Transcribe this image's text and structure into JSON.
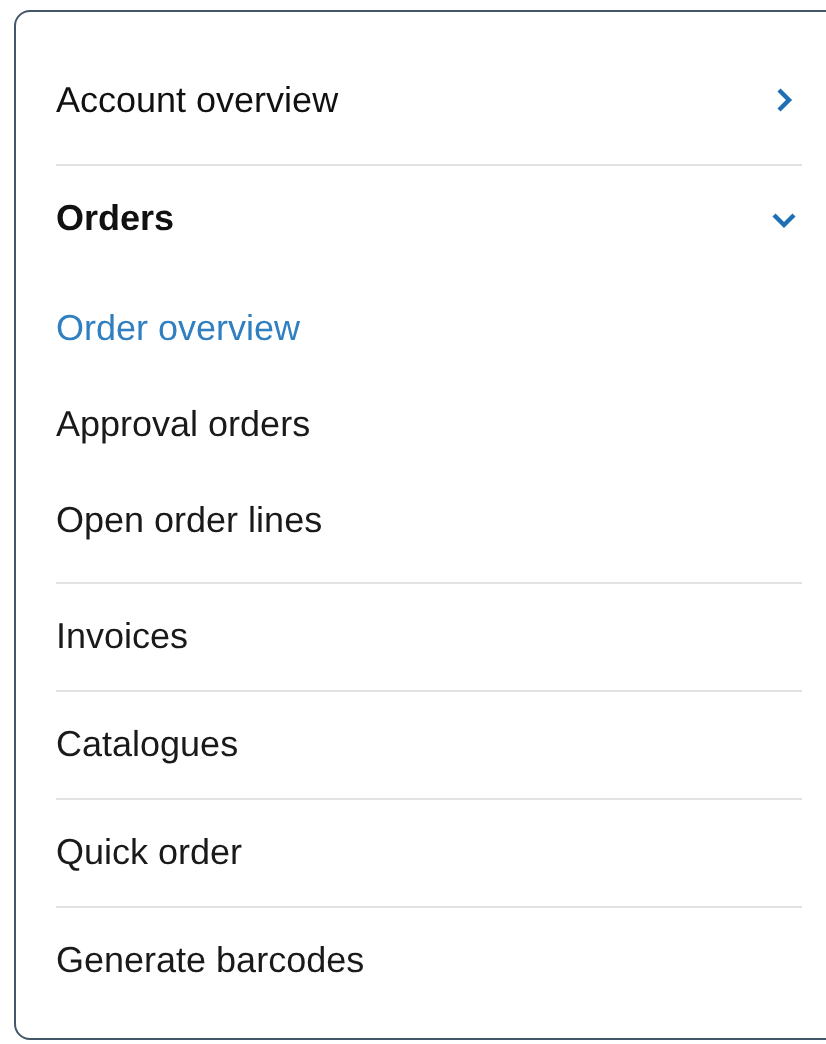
{
  "menu": [
    {
      "label": "Account overview",
      "kind": "group",
      "expanded": false
    },
    {
      "label": "Orders",
      "kind": "group",
      "expanded": true,
      "children": [
        {
          "label": "Order overview",
          "selected": true
        },
        {
          "label": "Approval orders",
          "selected": false
        },
        {
          "label": "Open order lines",
          "selected": false
        }
      ]
    },
    {
      "label": "Invoices",
      "kind": "link"
    },
    {
      "label": "Catalogues",
      "kind": "link"
    },
    {
      "label": "Quick order",
      "kind": "link"
    },
    {
      "label": "Generate barcodes",
      "kind": "link"
    }
  ]
}
